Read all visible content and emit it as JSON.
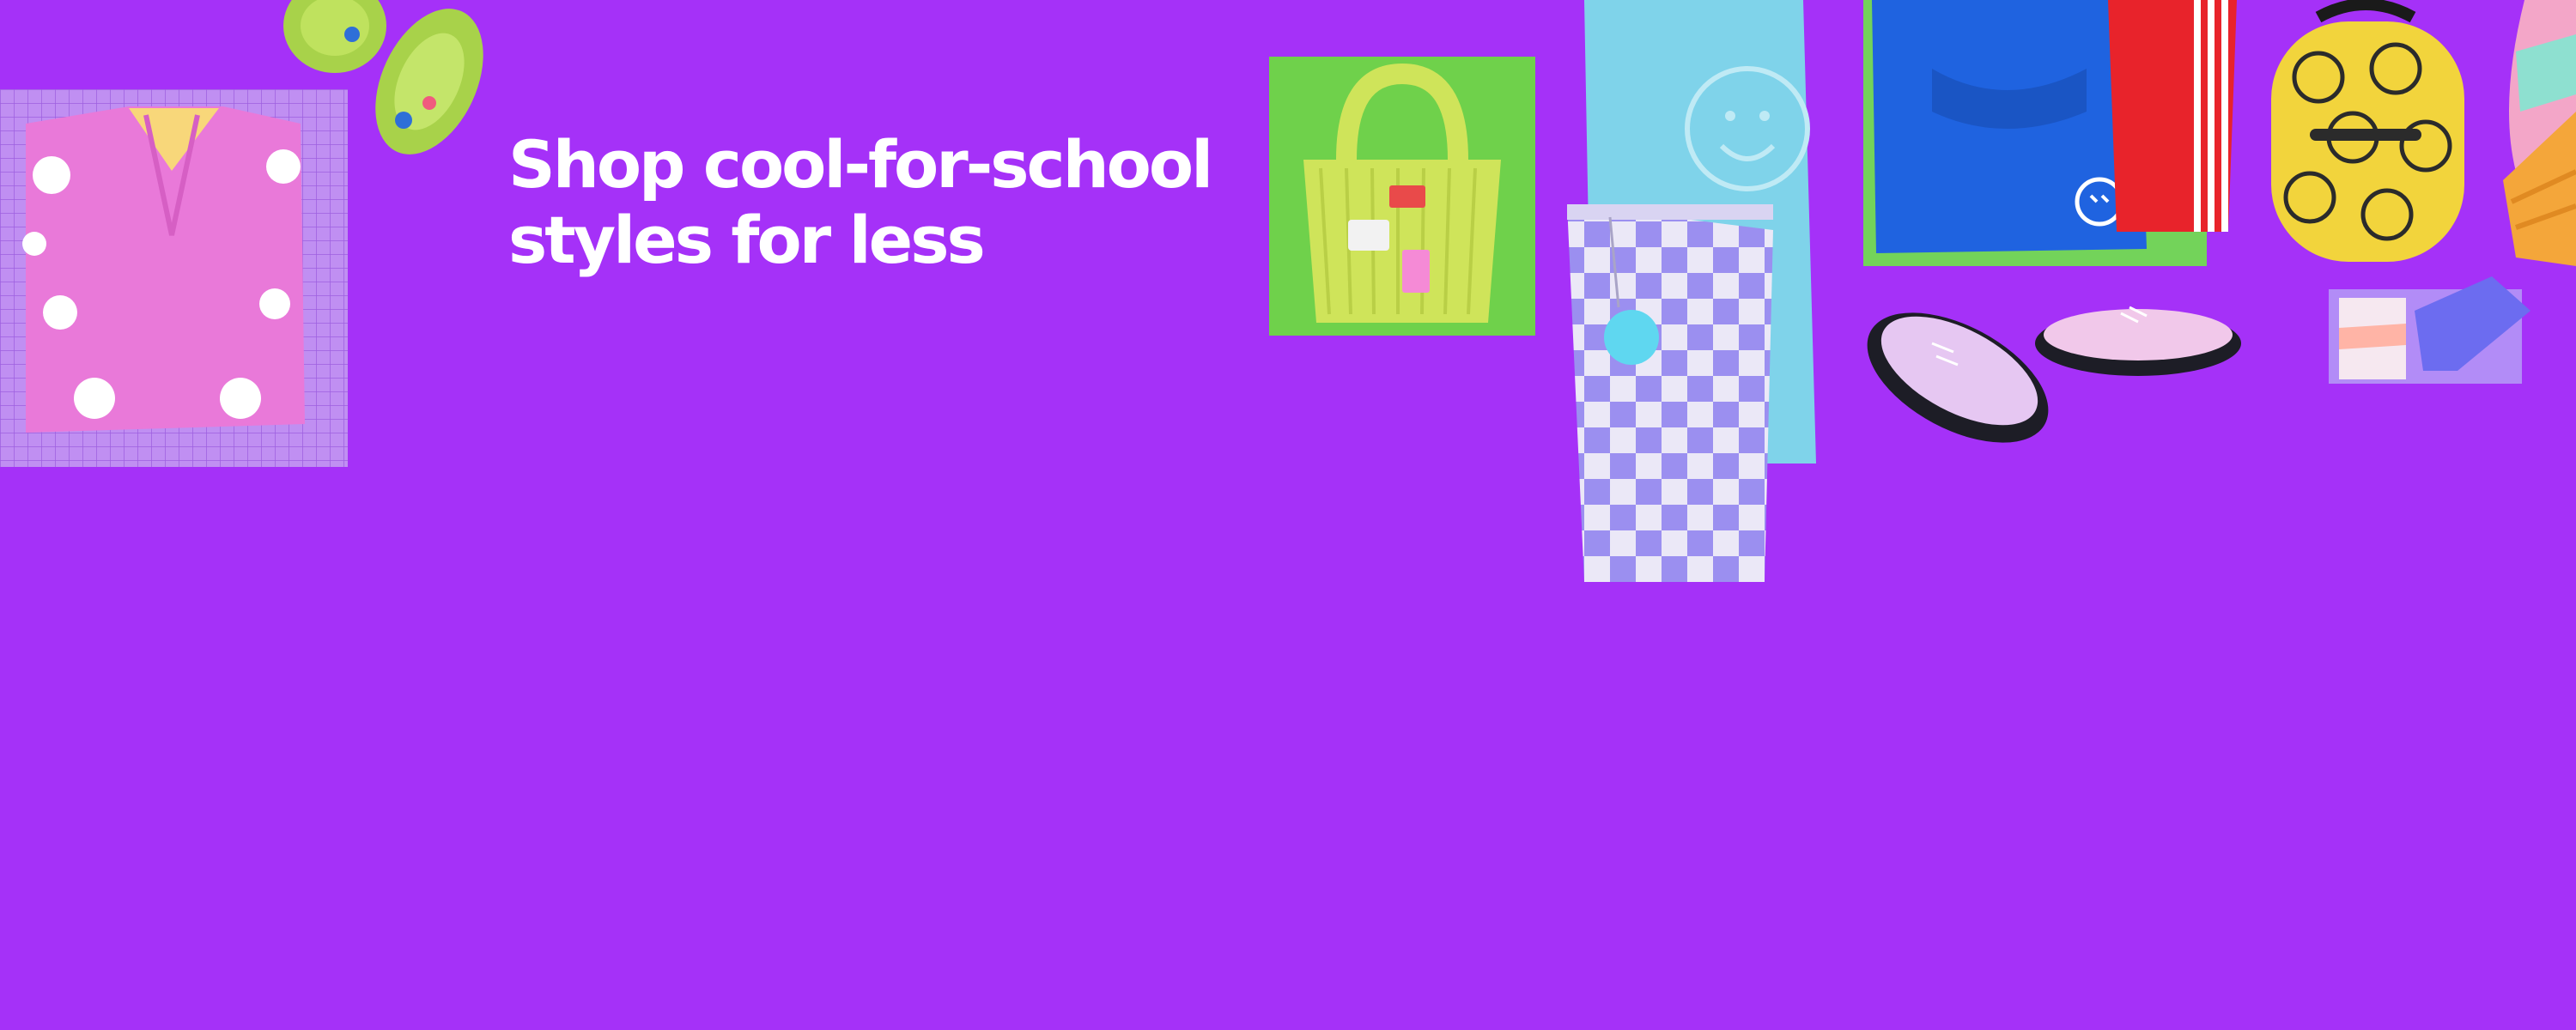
{
  "banner": {
    "headline_line1": "Shop cool-for-school",
    "headline_line2": "styles for less"
  },
  "colors": {
    "background": "#a531f8",
    "headline": "#ffffff"
  },
  "products": [
    "pink-floral-cardigan-image",
    "lime-clogs-image",
    "lime-corduroy-tote-image",
    "checkered-jeans-image",
    "aqua-smiley-sweatshirt-image",
    "blue-hoodie-image",
    "red-track-pants-image",
    "lilac-oxford-shoes-image",
    "smiley-backpack-image",
    "socks-image",
    "beanie-image"
  ]
}
